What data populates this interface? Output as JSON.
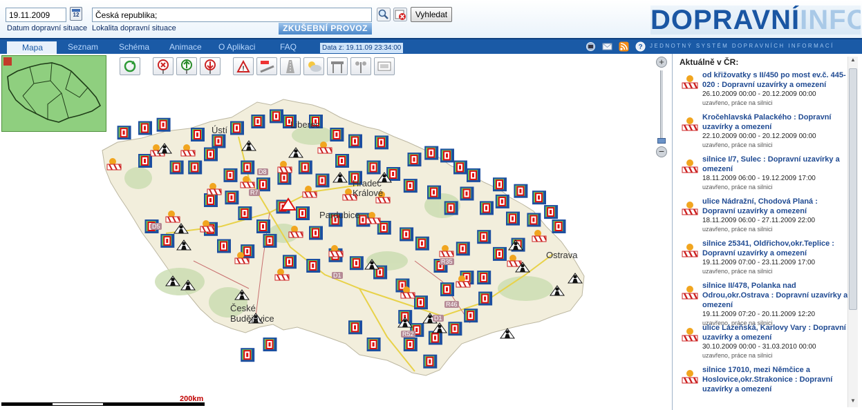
{
  "header": {
    "date_value": "19.11.2009",
    "date_label": "Datum dopravní situace",
    "calendar_text": "12",
    "location_value": "Česká republika;",
    "location_label": "Lokalita dopravní situace",
    "test_banner": "ZKUŠEBNÍ PROVOZ",
    "search_button": "Vyhledat",
    "logo_part1": "DOPRAVNÍ",
    "logo_part2": "INFO"
  },
  "nav": {
    "tabs": [
      "Mapa",
      "Seznam",
      "Schéma",
      "Animace",
      "O Aplikaci",
      "FAQ"
    ],
    "data_time": "Data z: 19.11.09 23:34:00",
    "tagline": "JEDNOTNÝ SYSTÉM DOPRAVNÍCH INFORMACÍ"
  },
  "map": {
    "scale_label": "200km",
    "cities": [
      "Ústí",
      "Liberec",
      "Hradec Králové",
      "Pardubice",
      "České Budějovice",
      "Ostrava"
    ],
    "roads": [
      "D8",
      "D1",
      "D1",
      "R52",
      "R46",
      "R35",
      "D5",
      "R7"
    ]
  },
  "panel": {
    "title": "Aktuálně v ČR:",
    "events": [
      {
        "title": "od křižovatky s II/450 po most ev.č. 445-020 : Dopravní uzavírky a omezení",
        "dates": "26.10.2009 00:00 - 20.12.2009 00:00",
        "status": "uzavřeno, práce na silnici"
      },
      {
        "title": "Kročehlavská Palackého : Dopravní uzavírky a omezení",
        "dates": "22.10.2009 00:00 - 20.12.2009 00:00",
        "status": "uzavřeno, práce na silnici"
      },
      {
        "title": "silnice I/7, Sulec : Dopravní uzavírky a omezení",
        "dates": "18.11.2009 06:00 - 19.12.2009 17:00",
        "status": "uzavřeno, práce na silnici"
      },
      {
        "title": "ulice Nádražní, Chodová Planá : Dopravní uzavírky a omezení",
        "dates": "18.11.2009 06:00 - 27.11.2009 22:00",
        "status": "uzavřeno, práce na silnici"
      },
      {
        "title": "silnice 25341, Oldřichov,okr.Teplice : Dopravní uzavírky a omezení",
        "dates": "19.11.2009 07:00 - 23.11.2009 17:00",
        "status": "uzavřeno, práce na silnici"
      },
      {
        "title": "silnice II/478, Polanka nad Odrou,okr.Ostrava : Dopravní uzavírky a omezení",
        "dates": "19.11.2009 07:20 - 20.11.2009 12:20",
        "status": "uzavřeno, práce na silnici"
      },
      {
        "title": "ulice Lázeňská, Karlovy Vary : Dopravní uzavírky a omezení",
        "dates": "30.10.2009 00:00 - 31.03.2010 00:00",
        "status": "uzavřeno, práce na silnici"
      },
      {
        "title": "silnice 17010, mezi Němčice a Hoslovice,okr.Strakonice : Dopravní uzavírky a omezení",
        "dates": "",
        "status": ""
      }
    ]
  },
  "colors": {
    "nav_blue": "#1a5aa6",
    "link_blue": "#1f4a92",
    "map_land": "#f2eedc",
    "forest": "#c9dcb0"
  }
}
